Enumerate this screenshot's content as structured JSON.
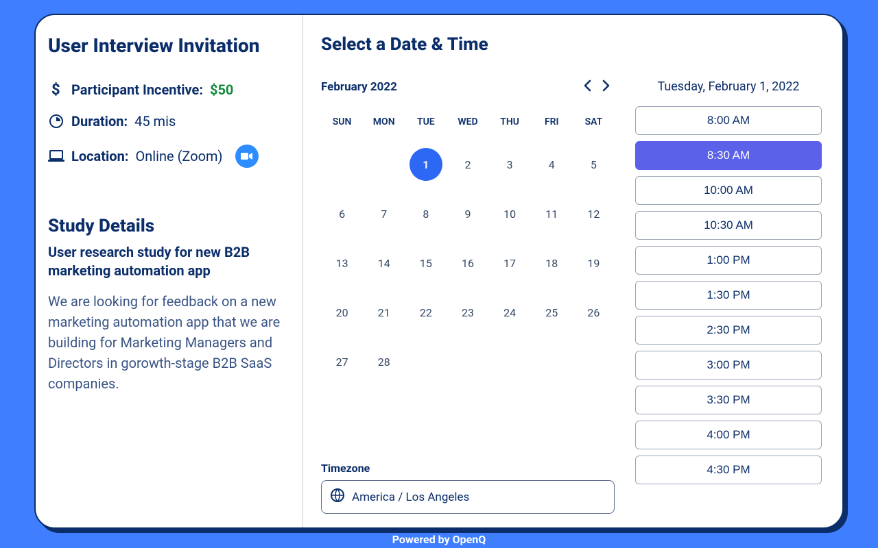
{
  "left": {
    "title": "User Interview Invitation",
    "incentive_label": "Participant Incentive:",
    "incentive_value": "$50",
    "duration_label": "Duration:",
    "duration_value": "45 mis",
    "location_label": "Location:",
    "location_value": "Online (Zoom)",
    "study_heading": "Study Details",
    "study_subtitle": "User research study for new B2B marketing automation app",
    "study_description": "We are looking for feedback on a new marketing automation app that we are building for Marketing Managers and Directors in gorowth-stage B2B SaaS companies."
  },
  "right": {
    "heading": "Select a Date & Time",
    "month_label": "February 2022",
    "dow": [
      "SUN",
      "MON",
      "TUE",
      "WED",
      "THU",
      "FRI",
      "SAT"
    ],
    "days": [
      [
        "",
        "",
        "1",
        "2",
        "3",
        "4",
        "5"
      ],
      [
        "6",
        "7",
        "8",
        "9",
        "10",
        "11",
        "12"
      ],
      [
        "13",
        "14",
        "15",
        "16",
        "17",
        "18",
        "19"
      ],
      [
        "20",
        "21",
        "22",
        "23",
        "24",
        "25",
        "26"
      ],
      [
        "27",
        "28",
        "",
        "",
        "",
        "",
        ""
      ]
    ],
    "selected_day": "1",
    "tz_label": "Timezone",
    "tz_value": "America / Los Angeles",
    "selected_date_display": "Tuesday, February 1, 2022",
    "times": [
      "8:00 AM",
      "8:30 AM",
      "10:00 AM",
      "10:30 AM",
      "1:00 PM",
      "1:30 PM",
      "2:30 PM",
      "3:00 PM",
      "3:30 PM",
      "4:00 PM",
      "4:30 PM"
    ],
    "selected_time": "8:30 AM"
  },
  "footer": "Powered by OpenQ"
}
